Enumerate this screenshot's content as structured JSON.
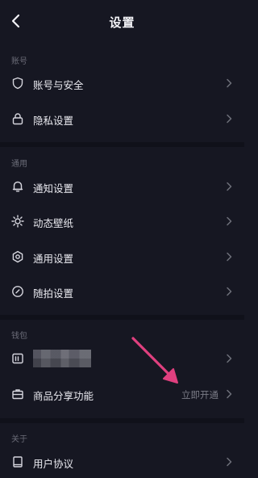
{
  "header": {
    "title": "设置"
  },
  "sections": {
    "account": "账号",
    "general": "通用",
    "wallet": "钱包",
    "about": "关于"
  },
  "items": {
    "account_security": "账号与安全",
    "privacy": "隐私设置",
    "notifications": "通知设置",
    "wallpaper": "动态壁纸",
    "general_settings": "通用设置",
    "quick_shot": "随拍设置",
    "wallet_hidden": "",
    "product_share": "商品分享功能",
    "product_share_value": "立即开通",
    "user_agreement": "用户协议"
  },
  "icons": {
    "back": "chevron-left-icon",
    "shield": "shield-icon",
    "lock": "lock-icon",
    "bell": "bell-icon",
    "wallpaper": "gear-sun-icon",
    "general": "hex-gear-icon",
    "quick_shot": "clock-check-icon",
    "wallet": "wallet-card-icon",
    "shop": "briefcase-icon",
    "agreement": "book-icon"
  },
  "colors": {
    "background": "#161722",
    "annotation_arrow": "#e0407f"
  }
}
